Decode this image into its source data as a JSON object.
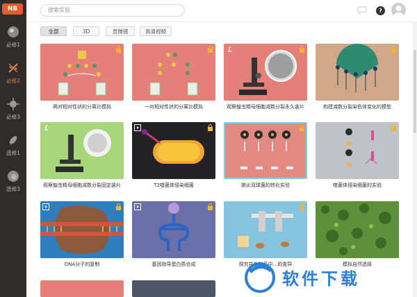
{
  "app": {
    "logo": "NB"
  },
  "sidebar": {
    "items": [
      {
        "label": "必修1",
        "icon": "cell-icon",
        "active": false
      },
      {
        "label": "必修2",
        "icon": "dna-icon",
        "active": true
      },
      {
        "label": "必修3",
        "icon": "virus-icon",
        "active": false
      },
      {
        "label": "选修1",
        "icon": "bacteria-icon",
        "active": false
      },
      {
        "label": "选修3",
        "icon": "organelle-icon",
        "active": false
      }
    ]
  },
  "search": {
    "placeholder": "搜索实验"
  },
  "header": {
    "help_label": "?"
  },
  "filters": [
    {
      "label": "全部",
      "active": true
    },
    {
      "label": "3D",
      "active": false
    },
    {
      "label": "显微镜",
      "active": false
    },
    {
      "label": "高清视频",
      "active": false
    }
  ],
  "cards": [
    {
      "title": "两对相对性状的分离比模拟",
      "bg": "#e47f79",
      "type": "none",
      "locked": true
    },
    {
      "title": "一对相对性状的分离比模拟",
      "bg": "#e47f79",
      "type": "none",
      "locked": true
    },
    {
      "title": "观察蝗虫精母细胞减数分裂永久装片",
      "bg": "#e47f79",
      "type": "microscope",
      "locked": true
    },
    {
      "title": "构建减数分裂染色体变化的模型",
      "bg": "#d1a78a",
      "type": "none",
      "locked": true
    },
    {
      "title": "观察蝗虫精母细胞减数分裂固定装片",
      "bg": "#a9d67a",
      "type": "microscope",
      "locked": false
    },
    {
      "title": "T2噬菌体侵染细菌",
      "bg": "#232326",
      "type": "video",
      "locked": true
    },
    {
      "title": "肺炎双球菌的转化实验",
      "bg": "#e28a82",
      "type": "none",
      "locked": true
    },
    {
      "title": "噬菌体侵染细菌的实验",
      "bg": "#bfc3c8",
      "type": "none",
      "locked": true
    },
    {
      "title": "DNA分子的复制",
      "bg": "#2f7fbf",
      "type": "video",
      "locked": true
    },
    {
      "title": "基因指导蛋白质合成",
      "bg": "#6a6fa8",
      "type": "video",
      "locked": true
    },
    {
      "title": "探究花生种子中...的变异",
      "bg": "#86c3dd",
      "type": "none",
      "locked": true
    },
    {
      "title": "模拟自然选择",
      "bg": "#5e8f3a",
      "type": "none",
      "locked": false
    }
  ],
  "watermark": {
    "text": "软件下载"
  },
  "colors": {
    "accent": "#e85a2b",
    "sidebar": "#2f2c2b",
    "active_nav": "#e8834d"
  }
}
